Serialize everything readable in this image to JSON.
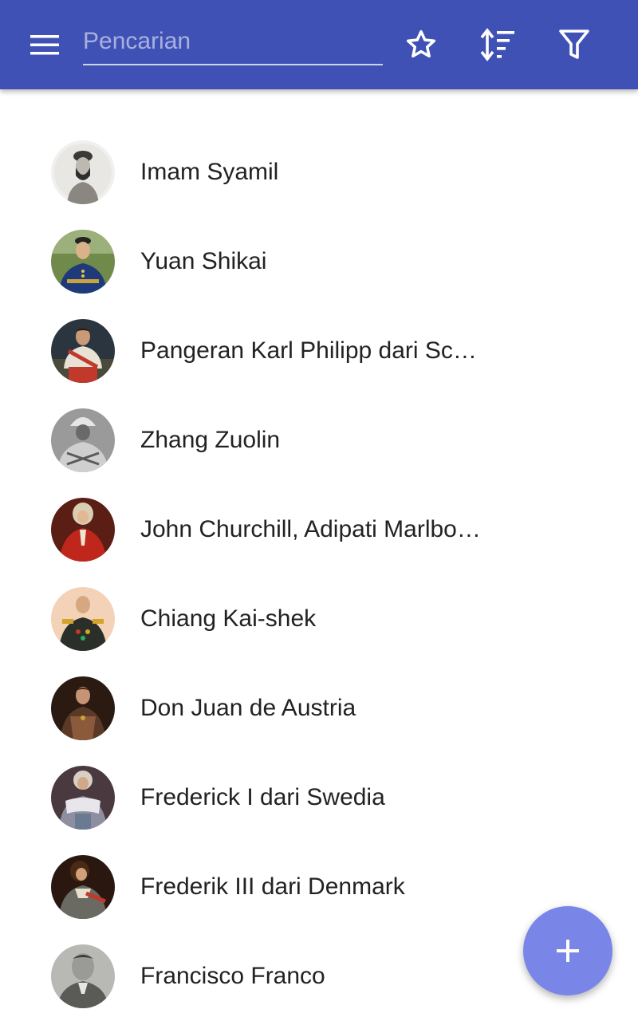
{
  "appbar": {
    "menu_icon": "menu-icon",
    "search": {
      "value": "",
      "placeholder": "Pencarian"
    },
    "actions": [
      "star-icon",
      "sort-icon",
      "filter-icon"
    ]
  },
  "list": {
    "items": [
      {
        "label": "Imam Syamil"
      },
      {
        "label": "Yuan Shikai"
      },
      {
        "label": "Pangeran Karl Philipp dari Sc…"
      },
      {
        "label": "Zhang Zuolin"
      },
      {
        "label": "John Churchill, Adipati Marlbo…"
      },
      {
        "label": "Chiang Kai-shek"
      },
      {
        "label": "Don Juan de Austria"
      },
      {
        "label": "Frederick I dari Swedia"
      },
      {
        "label": "Frederik III dari Denmark"
      },
      {
        "label": "Francisco Franco"
      }
    ]
  },
  "fab": {
    "icon": "plus-icon"
  },
  "colors": {
    "appbar": "#3f51b5",
    "fab": "#7986e8",
    "text": "#222222"
  }
}
